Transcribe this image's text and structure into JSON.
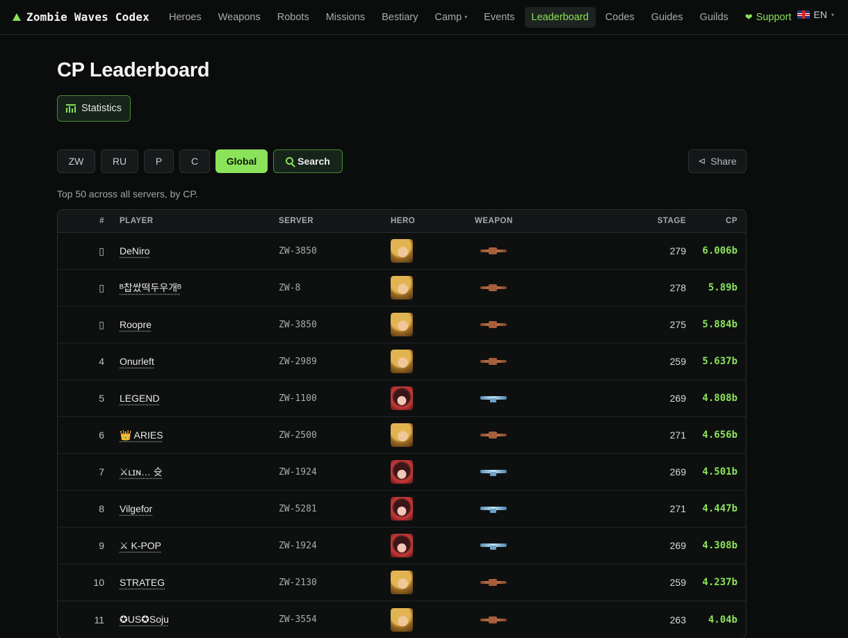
{
  "nav": {
    "brand": "Zombie Waves Codex",
    "items": [
      {
        "label": "Heroes"
      },
      {
        "label": "Weapons"
      },
      {
        "label": "Robots"
      },
      {
        "label": "Missions"
      },
      {
        "label": "Bestiary"
      },
      {
        "label": "Camp"
      },
      {
        "label": "Events"
      },
      {
        "label": "Leaderboard"
      },
      {
        "label": "Codes"
      },
      {
        "label": "Guides"
      },
      {
        "label": "Guilds"
      },
      {
        "label": "Support"
      }
    ],
    "active": "Leaderboard",
    "language": "EN"
  },
  "page": {
    "title": "CP Leaderboard",
    "statistics_label": "Statistics",
    "subtitle": "Top 50 across all servers, by CP."
  },
  "filters": {
    "buttons": [
      "ZW",
      "RU",
      "P",
      "C",
      "Global"
    ],
    "active": "Global",
    "search_label": "Search",
    "share_label": "Share"
  },
  "table": {
    "headers": [
      "#",
      "PLAYER",
      "SERVER",
      "HERO",
      "WEAPON",
      "STAGE",
      "CP"
    ],
    "rows": [
      {
        "rank": "▯",
        "player": "DeNiro",
        "server": "ZW-3850",
        "hero": "blond",
        "weapon": "copper",
        "stage": "279",
        "cp": "6.006b"
      },
      {
        "rank": "▯",
        "player": "ᴮ찹쌌떡두우개ᴮ",
        "server": "ZW-8",
        "hero": "blond",
        "weapon": "copper",
        "stage": "278",
        "cp": "5.89b"
      },
      {
        "rank": "▯",
        "player": "Roopre",
        "server": "ZW-3850",
        "hero": "blond",
        "weapon": "copper",
        "stage": "275",
        "cp": "5.884b"
      },
      {
        "rank": "4",
        "player": "Onurleft",
        "server": "ZW-2989",
        "hero": "blond",
        "weapon": "copper",
        "stage": "259",
        "cp": "5.637b"
      },
      {
        "rank": "5",
        "player": "LEGEND",
        "server": "ZW-1100",
        "hero": "dark",
        "weapon": "blue",
        "stage": "269",
        "cp": "4.808b"
      },
      {
        "rank": "6",
        "player": "👑 ARIES",
        "server": "ZW-2500",
        "hero": "blond",
        "weapon": "copper",
        "stage": "271",
        "cp": "4.656b"
      },
      {
        "rank": "7",
        "player": "⚔ʟɪɴ… 슛",
        "server": "ZW-1924",
        "hero": "dark",
        "weapon": "blue",
        "stage": "269",
        "cp": "4.501b"
      },
      {
        "rank": "8",
        "player": "Vilgefor",
        "server": "ZW-5281",
        "hero": "dark",
        "weapon": "blue",
        "stage": "271",
        "cp": "4.447b"
      },
      {
        "rank": "9",
        "player": "⚔ K-POP",
        "server": "ZW-1924",
        "hero": "dark",
        "weapon": "blue",
        "stage": "269",
        "cp": "4.308b"
      },
      {
        "rank": "10",
        "player": "STRATEG",
        "server": "ZW-2130",
        "hero": "blond",
        "weapon": "copper",
        "stage": "259",
        "cp": "4.237b"
      },
      {
        "rank": "11",
        "player": "✪US✪Soju",
        "server": "ZW-3554",
        "hero": "blond",
        "weapon": "copper",
        "stage": "263",
        "cp": "4.04b"
      }
    ]
  },
  "colors": {
    "accent": "#8be35a",
    "background": "#0b0c0c"
  }
}
